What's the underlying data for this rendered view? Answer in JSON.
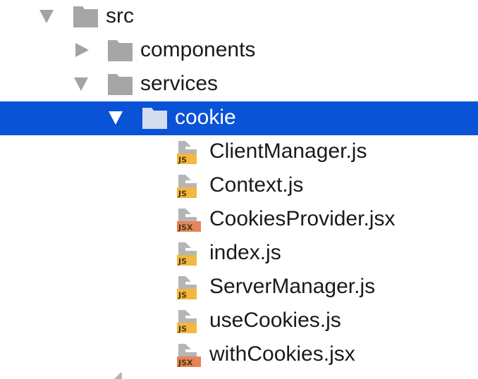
{
  "tree": {
    "nodes": [
      {
        "label": "src",
        "kind": "folder",
        "depth": 0,
        "expanded": true,
        "selected": false
      },
      {
        "label": "components",
        "kind": "folder",
        "depth": 1,
        "expanded": false,
        "selected": false
      },
      {
        "label": "services",
        "kind": "folder",
        "depth": 1,
        "expanded": true,
        "selected": false
      },
      {
        "label": "cookie",
        "kind": "folder",
        "depth": 2,
        "expanded": true,
        "selected": true
      },
      {
        "label": "ClientManager.js",
        "kind": "file",
        "badge": "JS",
        "depth": 3
      },
      {
        "label": "Context.js",
        "kind": "file",
        "badge": "JS",
        "depth": 3
      },
      {
        "label": "CookiesProvider.jsx",
        "kind": "file",
        "badge": "JSX",
        "depth": 3
      },
      {
        "label": "index.js",
        "kind": "file",
        "badge": "JS",
        "depth": 3
      },
      {
        "label": "ServerManager.js",
        "kind": "file",
        "badge": "JS",
        "depth": 3
      },
      {
        "label": "useCookies.js",
        "kind": "file",
        "badge": "JS",
        "depth": 3
      },
      {
        "label": "withCookies.jsx",
        "kind": "file",
        "badge": "JSX",
        "depth": 3
      }
    ]
  },
  "colors": {
    "selection": "#0a52d6",
    "folder": "#a6a6a6",
    "folder_selected": "#d4ddef",
    "arrow": "#a3a3a3",
    "js_badge": "#f2b840",
    "jsx_badge": "#e8835a",
    "page_fold": "#b5b5b5"
  }
}
